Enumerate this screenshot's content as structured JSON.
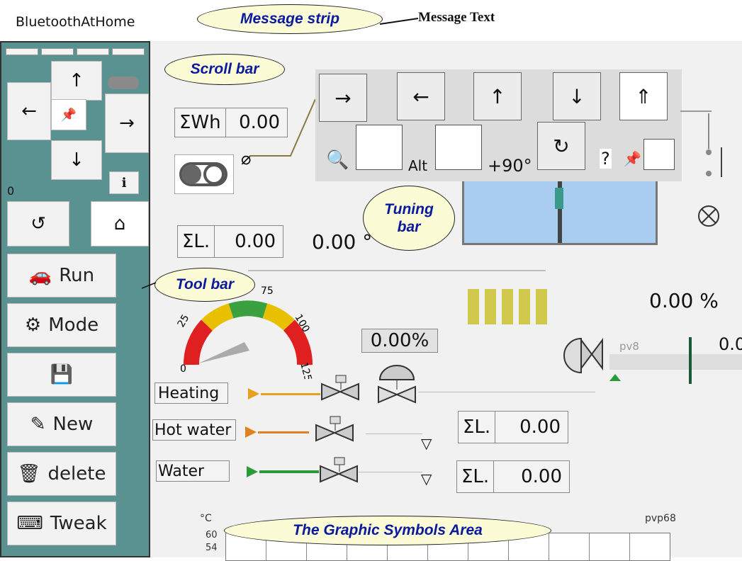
{
  "app": {
    "title": "BluetoothAtHome"
  },
  "callouts": {
    "message_strip": "Message strip",
    "message_text": "Message Text",
    "scroll_bar": "Scroll bar",
    "tuning_bar_line1": "Tuning",
    "tuning_bar_line2": "bar",
    "tool_bar": "Tool bar",
    "graphic_area": "The Graphic Symbols Area"
  },
  "sidebar": {
    "counter": "0",
    "tools": [
      {
        "icon": "car-icon",
        "label": "Run"
      },
      {
        "icon": "gear-icon",
        "label": "Mode"
      },
      {
        "icon": "save-icon",
        "label": ""
      },
      {
        "icon": "pencil-icon",
        "label": "New"
      },
      {
        "icon": "trash-icon",
        "label": "delete"
      },
      {
        "icon": "keyboard-icon",
        "label": "Tweak"
      }
    ]
  },
  "tuning": {
    "alt_label": "Alt",
    "rotate_label": "+90°",
    "help_label": "?"
  },
  "readouts": {
    "wh_label": "ΣWh",
    "wh_value": "0.00",
    "l1_label": "ΣL.",
    "l1_value": "0.00",
    "angle": "0.00 °",
    "percent_box": "0.00%",
    "percent_right": "0.00 %",
    "right_edge_value": "0.0",
    "pv8": "pv8",
    "l2_label": "ΣL.",
    "l2_value": "0.00",
    "l3_label": "ΣL.",
    "l3_value": "0.00",
    "pvp68": "pvp68"
  },
  "gauge": {
    "ticks": [
      "0",
      "25",
      "75",
      "100",
      "125"
    ],
    "value": 0,
    "max": 125,
    "colors": {
      "red": "#e02020",
      "yellow": "#e8c000",
      "green": "#3aa040"
    }
  },
  "lines": [
    {
      "label": "Heating",
      "color": "#e8a020"
    },
    {
      "label": "Hot water",
      "color": "#e08020"
    },
    {
      "label": "Water",
      "color": "#2a9a3a"
    }
  ],
  "chart": {
    "unit": "°C",
    "y_ticks": [
      "60",
      "54"
    ]
  },
  "colors": {
    "sidebar": "#5a9191",
    "callout_fill": "#fbfbd6",
    "callout_text": "#0a1a9e",
    "tank": "#a8cdf0"
  }
}
